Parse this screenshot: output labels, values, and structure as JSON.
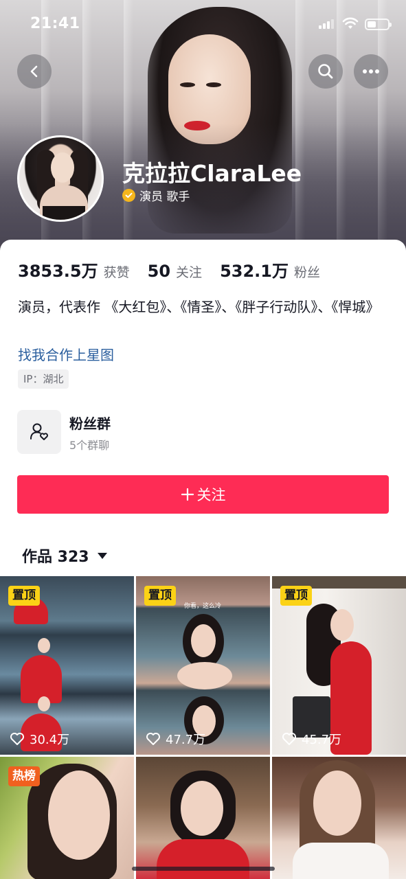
{
  "status_bar": {
    "time": "21:41"
  },
  "profile": {
    "nickname": "克拉拉ClaraLee",
    "verification": "演员 歌手",
    "stats": [
      {
        "value": "3853.5万",
        "label": "获赞"
      },
      {
        "value": "50",
        "label": "关注"
      },
      {
        "value": "532.1万",
        "label": "粉丝"
      }
    ],
    "bio": "演员，代表作 《大红包》、《情圣》、《胖子行动队》、《悍城》",
    "collab_link": "找我合作上星图",
    "ip_location": "IP：湖北"
  },
  "fan_group": {
    "title": "粉丝群",
    "subtitle": "5个群聊"
  },
  "follow_button": {
    "label": "关注"
  },
  "works": {
    "label": "作品 323"
  },
  "videos": [
    {
      "tag": "置顶",
      "likes": "30.4万"
    },
    {
      "tag": "置顶",
      "likes": "47.7万",
      "caption": "你看，这么冷"
    },
    {
      "tag": "置顶",
      "likes": "45.7万"
    },
    {
      "tag": "热榜",
      "likes": ""
    },
    {
      "tag": "",
      "likes": ""
    },
    {
      "tag": "",
      "likes": ""
    }
  ],
  "colors": {
    "accent": "#fe2c55",
    "pin_tag": "#fbd216",
    "hot_tag": "#f0601f",
    "link": "#2b5f9e",
    "verify_badge": "#f5b61c"
  },
  "icons": [
    "back-icon",
    "search-icon",
    "more-icon",
    "verified-icon",
    "fan-group-icon",
    "plus-icon",
    "dropdown-icon",
    "heart-icon"
  ]
}
